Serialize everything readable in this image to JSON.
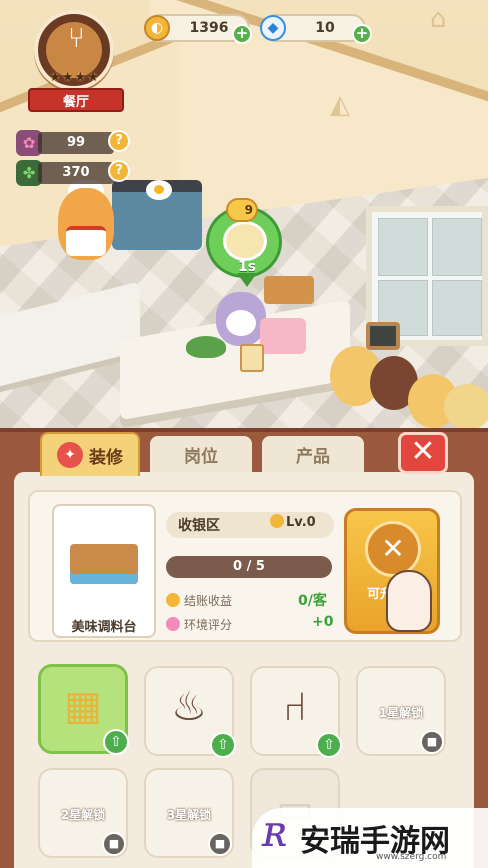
{
  "hud": {
    "restaurant_label": "餐厅",
    "stars": [
      "★",
      "★",
      "★",
      "★"
    ],
    "gold": "1396",
    "diamonds": "10",
    "flower_stat": "99",
    "clover_stat": "370",
    "plus": "+",
    "help": "?"
  },
  "scene": {
    "order_coin_count": "9",
    "order_timer": "1s"
  },
  "panel": {
    "tabs": [
      {
        "label": "装修",
        "active": true
      },
      {
        "label": "岗位",
        "active": false
      },
      {
        "label": "产品",
        "active": false
      }
    ],
    "close_symbol": "✕",
    "item_name": "美味调料台",
    "title": "收银区",
    "level": "Lv.0",
    "progress_text": "0 / 5",
    "progress_fraction": 0.0,
    "stats": [
      {
        "label": "结账收益",
        "value": "0/客"
      },
      {
        "label": "环境评分",
        "value": "+0"
      }
    ],
    "upgrade_label": "可升"
  },
  "slots": [
    {
      "name": "cash-register",
      "state": "selected",
      "glyph": "▦",
      "icon": "register-icon"
    },
    {
      "name": "cooking-pot",
      "state": "upgradable",
      "glyph": "♨",
      "icon": "pot-icon"
    },
    {
      "name": "chair",
      "state": "upgradable",
      "glyph": "⑁",
      "icon": "chair-icon"
    },
    {
      "name": "locked-1",
      "state": "locked",
      "text": "1星解锁"
    },
    {
      "name": "locked-2",
      "state": "locked",
      "text": "2星解锁"
    },
    {
      "name": "locked-3",
      "state": "locked",
      "text": "3星解锁"
    },
    {
      "name": "locked-4",
      "state": "ghost",
      "text": ""
    }
  ],
  "watermark": {
    "brand": "安瑞手游网",
    "url": "www.szerg.com"
  },
  "colors": {
    "panel_brown": "#9b5a3d",
    "tab_gold": "#f4d27a",
    "close_red": "#e2463d",
    "selected_green": "#b6e27d",
    "upgrade_gold": "#f0c34a"
  }
}
